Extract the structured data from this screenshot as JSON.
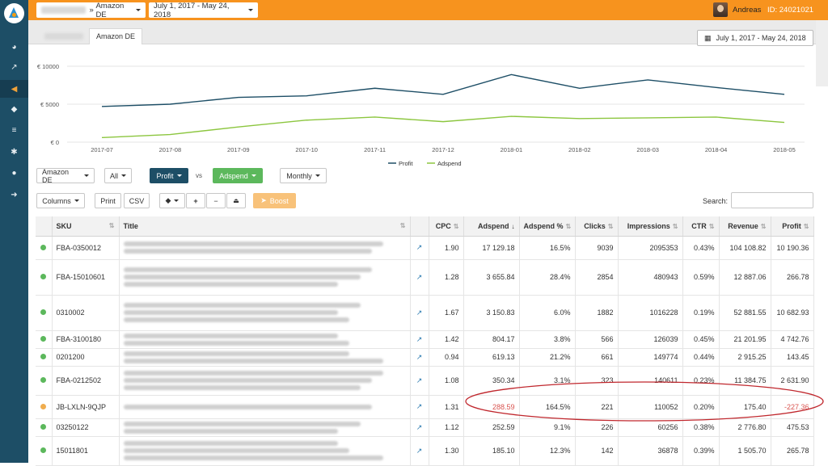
{
  "topbar": {
    "account_label": "»",
    "marketplace": "Amazon DE",
    "date_range": "July 1, 2017 - May 24, 2018",
    "user_name": "Andreas",
    "user_id": "ID: 24021021"
  },
  "tabs": {
    "active": "Amazon DE"
  },
  "date_range_button": "July 1, 2017 - May 24, 2018",
  "sidebar": {
    "items": [
      {
        "icon": "dashboard-icon",
        "glyph": "◕"
      },
      {
        "icon": "chart-icon",
        "glyph": "↗"
      },
      {
        "icon": "megaphone-icon",
        "glyph": "◀",
        "active": true
      },
      {
        "icon": "tag-icon",
        "glyph": "◆"
      },
      {
        "icon": "database-icon",
        "glyph": "≡"
      },
      {
        "icon": "cogs-icon",
        "glyph": "✱"
      },
      {
        "icon": "user-icon",
        "glyph": "●"
      },
      {
        "icon": "logout-icon",
        "glyph": "➜"
      }
    ]
  },
  "chart_data": {
    "type": "line",
    "x": [
      "2017-07",
      "2017-08",
      "2017-09",
      "2017-10",
      "2017-11",
      "2017-12",
      "2018-01",
      "2018-02",
      "2018-03",
      "2018-04",
      "2018-05"
    ],
    "series": [
      {
        "name": "Profit",
        "color": "#1d4e66",
        "values": [
          4700,
          5000,
          5900,
          6100,
          7100,
          6300,
          8900,
          7100,
          8200,
          7200,
          6300
        ]
      },
      {
        "name": "Adspend",
        "color": "#8cc63f",
        "values": [
          600,
          1000,
          2000,
          2900,
          3300,
          2700,
          3400,
          3100,
          3200,
          3300,
          2600
        ]
      }
    ],
    "y_ticks": [
      "€ 0",
      "€ 5000",
      "€ 10000"
    ],
    "ylim": [
      0,
      10000
    ],
    "grid": true,
    "legend_position": "bottom"
  },
  "toolbar1": {
    "marketplace": "Amazon DE",
    "filter": "All",
    "metric_a": "Profit",
    "vs": "vs",
    "metric_b": "Adspend",
    "interval": "Monthly"
  },
  "toolbar2": {
    "columns": "Columns",
    "print": "Print",
    "csv": "CSV",
    "boost": "Boost",
    "search_label": "Search:",
    "search_value": ""
  },
  "table": {
    "headers": [
      "SKU",
      "Title",
      "CPC",
      "Adspend",
      "Adspend %",
      "Clicks",
      "Impressions",
      "CTR",
      "Revenue",
      "Profit"
    ],
    "rows": [
      {
        "status": "#5cb85c",
        "sku": "FBA-0350012",
        "title_lines": 2,
        "cpc": "1.90",
        "adspend": "17 129.18",
        "adspend_pct": "16.5%",
        "clicks": "9039",
        "impressions": "2095353",
        "ctr": "0.43%",
        "revenue": "104 108.82",
        "profit": "10 190.36",
        "neg": false
      },
      {
        "status": "#5cb85c",
        "sku": "FBA-15010601",
        "title_lines": 3,
        "cpc": "1.28",
        "adspend": "3 655.84",
        "adspend_pct": "28.4%",
        "clicks": "2854",
        "impressions": "480943",
        "ctr": "0.59%",
        "revenue": "12 887.06",
        "profit": "266.78",
        "neg": false
      },
      {
        "status": "#5cb85c",
        "sku": "0310002",
        "title_lines": 3,
        "cpc": "1.67",
        "adspend": "3 150.83",
        "adspend_pct": "6.0%",
        "clicks": "1882",
        "impressions": "1016228",
        "ctr": "0.19%",
        "revenue": "52 881.55",
        "profit": "10 682.93",
        "neg": false
      },
      {
        "status": "#5cb85c",
        "sku": "FBA-3100180",
        "title_lines": 2,
        "cpc": "1.42",
        "adspend": "804.17",
        "adspend_pct": "3.8%",
        "clicks": "566",
        "impressions": "126039",
        "ctr": "0.45%",
        "revenue": "21 201.95",
        "profit": "4 742.76",
        "neg": false
      },
      {
        "status": "#5cb85c",
        "sku": "0201200",
        "title_lines": 2,
        "cpc": "0.94",
        "adspend": "619.13",
        "adspend_pct": "21.2%",
        "clicks": "661",
        "impressions": "149774",
        "ctr": "0.44%",
        "revenue": "2 915.25",
        "profit": "143.45",
        "neg": false
      },
      {
        "status": "#5cb85c",
        "sku": "FBA-0212502",
        "title_lines": 3,
        "cpc": "1.08",
        "adspend": "350.34",
        "adspend_pct": "3.1%",
        "clicks": "323",
        "impressions": "140611",
        "ctr": "0.23%",
        "revenue": "11 384.75",
        "profit": "2 631.90",
        "neg": false
      },
      {
        "status": "#f0ad4e",
        "sku": "JB-LXLN-9QJP",
        "title_lines": 1,
        "cpc": "1.31",
        "adspend": "288.59",
        "adspend_pct": "164.5%",
        "clicks": "221",
        "impressions": "110052",
        "ctr": "0.20%",
        "revenue": "175.40",
        "profit": "-227.36",
        "neg": true
      },
      {
        "status": "#5cb85c",
        "sku": "03250122",
        "title_lines": 2,
        "cpc": "1.12",
        "adspend": "252.59",
        "adspend_pct": "9.1%",
        "clicks": "226",
        "impressions": "60256",
        "ctr": "0.38%",
        "revenue": "2 776.80",
        "profit": "475.53",
        "neg": false
      },
      {
        "status": "#5cb85c",
        "sku": "15011801",
        "title_lines": 3,
        "cpc": "1.30",
        "adspend": "185.10",
        "adspend_pct": "12.3%",
        "clicks": "142",
        "impressions": "36878",
        "ctr": "0.39%",
        "revenue": "1 505.70",
        "profit": "265.78",
        "neg": false
      }
    ]
  }
}
